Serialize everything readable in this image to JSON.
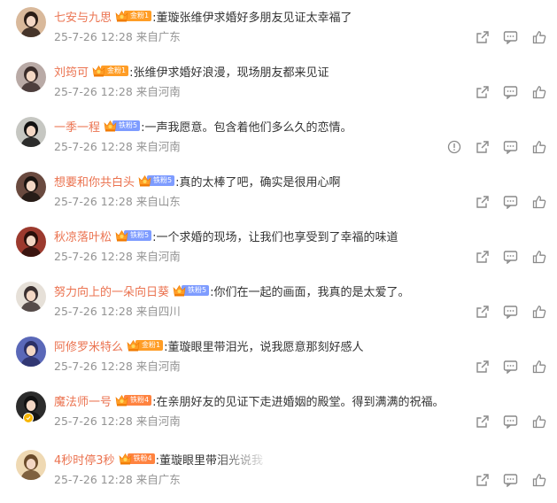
{
  "comments": [
    {
      "username": "七安与九思",
      "badge": {
        "label": "金粉1",
        "tier": "tier1"
      },
      "text": ":董璇张维伊求婚好多朋友见证太幸福了",
      "time": "25-7-26 12:28",
      "location": "来自广东",
      "has_report": false,
      "avatar_color": "#d9b99b"
    },
    {
      "username": "刘筠可",
      "badge": {
        "label": "金粉1",
        "tier": "tier1"
      },
      "text": ":张维伊求婚好浪漫，现场朋友都来见证",
      "time": "25-7-26 12:28",
      "location": "来自河南",
      "has_report": false,
      "avatar_color": "#b9aaa6"
    },
    {
      "username": "一季一程",
      "badge": {
        "label": "铁粉5",
        "tier": "tier5"
      },
      "text": ":一声我愿意。包含着他们多么久的恋情。",
      "time": "25-7-26 12:28",
      "location": "来自河南",
      "has_report": true,
      "avatar_color": "#c6c7c2"
    },
    {
      "username": "想要和你共白头",
      "badge": {
        "label": "铁粉5",
        "tier": "tier5"
      },
      "text": ":真的太棒了吧，确实是很用心啊",
      "time": "25-7-26 12:28",
      "location": "来自山东",
      "has_report": false,
      "avatar_color": "#6a4a3f"
    },
    {
      "username": "秋凉落叶松",
      "badge": {
        "label": "铁粉5",
        "tier": "tier5"
      },
      "text": ":一个求婚的现场，让我们也享受到了幸福的味道",
      "time": "25-7-26 12:28",
      "location": "来自河南",
      "has_report": false,
      "avatar_color": "#9c3a2e"
    },
    {
      "username": "努力向上的一朵向日葵",
      "badge": {
        "label": "铁粉5",
        "tier": "tier5"
      },
      "text": ":你们在一起的画面，我真的是太爱了。",
      "time": "25-7-26 12:28",
      "location": "来自四川",
      "has_report": false,
      "avatar_color": "#e6e0d8"
    },
    {
      "username": "阿修罗米特么",
      "badge": {
        "label": "金粉1",
        "tier": "tier1"
      },
      "text": ":董璇眼里带泪光，说我愿意那刻好感人",
      "time": "25-7-26 12:28",
      "location": "来自河南",
      "has_report": false,
      "avatar_color": "#5a68b8"
    },
    {
      "username": "魔法师一号",
      "badge": {
        "label": "铁粉4",
        "tier": "tier4"
      },
      "text": ":在亲朋好友的见证下走进婚姻的殿堂。得到满满的祝福。",
      "time": "25-7-26 12:28",
      "location": "来自河南",
      "has_report": false,
      "avatar_color": "#2c2c2c",
      "verified": true
    },
    {
      "username": "4秒时停3秒",
      "badge": {
        "label": "铁粉4",
        "tier": "tier4"
      },
      "text": ":董璇眼里带泪光说我",
      "time": "25-7-26 12:28",
      "location": "来自广东",
      "has_report": false,
      "avatar_color": "#efd9b3",
      "faded": true
    }
  ],
  "colors": {
    "username": "#eb7350",
    "meta": "#939393",
    "text": "#333333",
    "icon": "#8a8a8a"
  },
  "icons": {
    "share": "share-icon",
    "comment": "comment-icon",
    "like": "like-icon",
    "report": "report-icon",
    "badge": "crown-badge-icon"
  }
}
